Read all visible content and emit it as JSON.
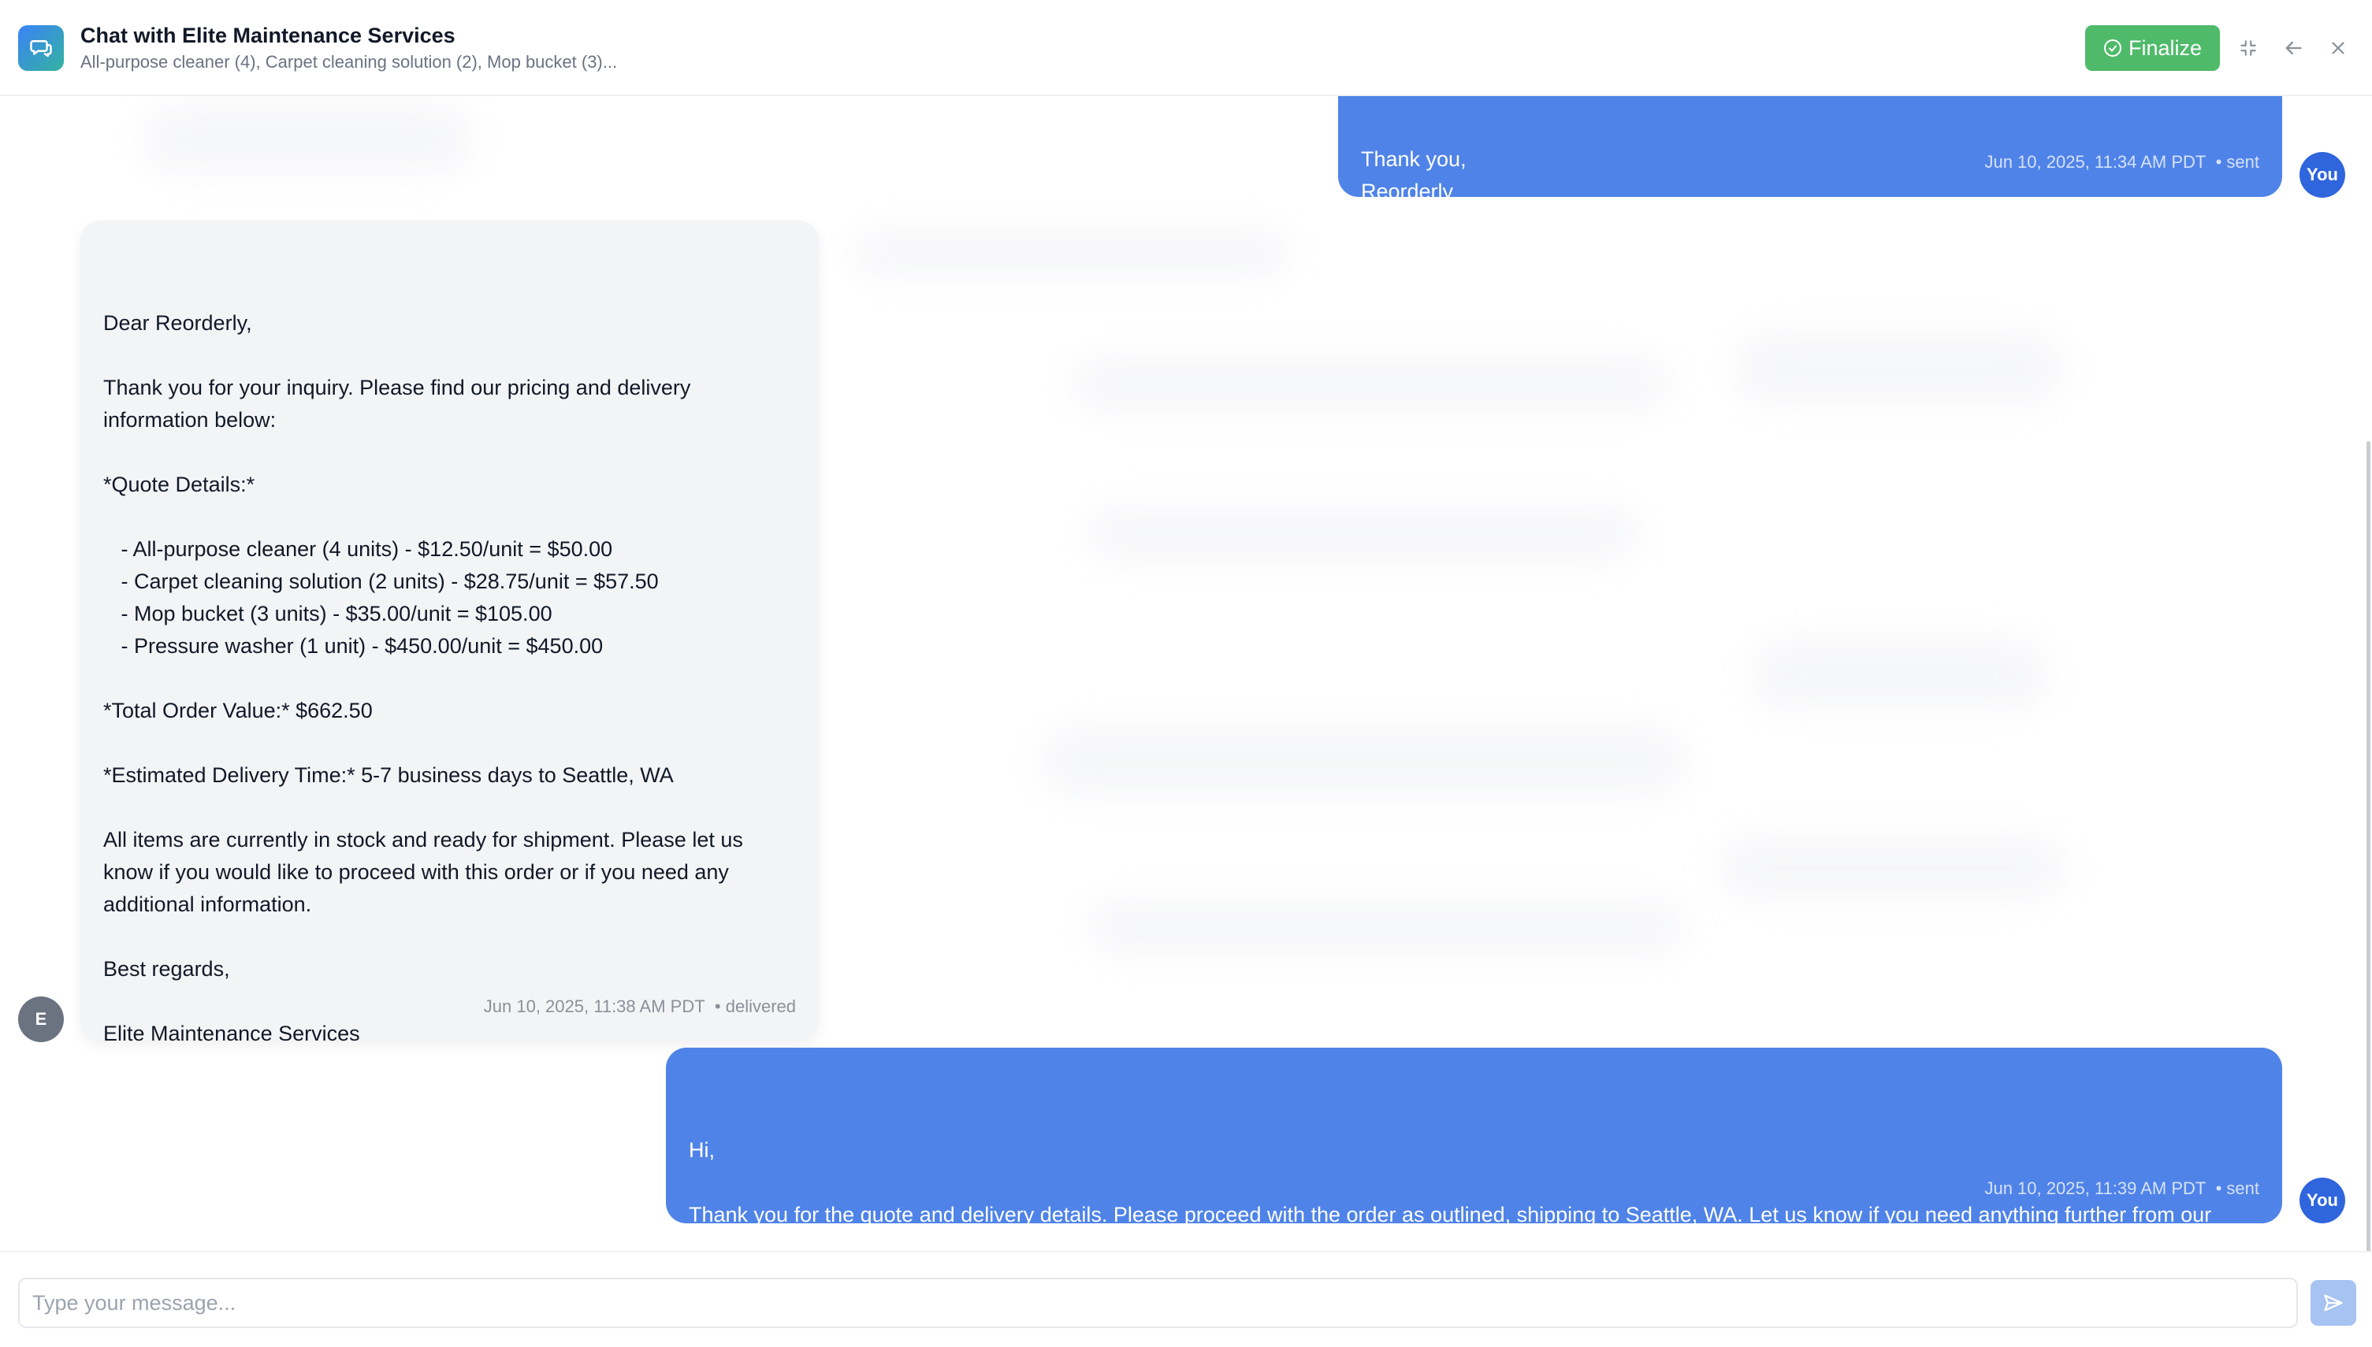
{
  "header": {
    "title": "Chat with Elite Maintenance Services",
    "subtitle": "All-purpose cleaner (4), Carpet cleaning solution (2), Mop bucket (3)...",
    "finalize_label": "Finalize",
    "icons": [
      "chat-bubbles-icon",
      "check-circle-icon",
      "minimize-icon",
      "back-arrow-icon",
      "close-icon"
    ]
  },
  "messages": [
    {
      "direction": "sent",
      "text": "Thank you,\nReorderly",
      "timestamp": "Jun 10, 2025, 11:34 AM PDT",
      "status": "• sent",
      "avatar": "You"
    },
    {
      "direction": "received",
      "text": "Dear Reorderly,\n\nThank you for your inquiry. Please find our pricing and delivery information below:\n\n*Quote Details:*\n\n   - All-purpose cleaner (4 units) - $12.50/unit = $50.00\n   - Carpet cleaning solution (2 units) - $28.75/unit = $57.50\n   - Mop bucket (3 units) - $35.00/unit = $105.00\n   - Pressure washer (1 unit) - $450.00/unit = $450.00\n\n*Total Order Value:* $662.50\n\n*Estimated Delivery Time:* 5-7 business days to Seattle, WA\n\nAll items are currently in stock and ready for shipment. Please let us know if you would like to proceed with this order or if you need any additional information.\n\nBest regards,\n\nElite Maintenance Services",
      "timestamp": "Jun 10, 2025, 11:38 AM PDT",
      "status": "• delivered",
      "avatar": "E"
    },
    {
      "direction": "sent",
      "text": "Hi,\n\nThank you for the quote and delivery details. Please proceed with the order as outlined, shipping to Seattle, WA. Let us know if you need anything further from our side.",
      "timestamp": "Jun 10, 2025, 11:39 AM PDT",
      "status": "• sent",
      "avatar": "You"
    }
  ],
  "composer": {
    "placeholder": "Type your message...",
    "value": ""
  },
  "colors": {
    "sent_bubble": "#4f83e8",
    "received_bubble": "#f3f4f6",
    "finalize": "#4fba6a",
    "you_avatar": "#2f65dd",
    "e_avatar": "#6b7280",
    "send_button": "#a7c3f2"
  }
}
